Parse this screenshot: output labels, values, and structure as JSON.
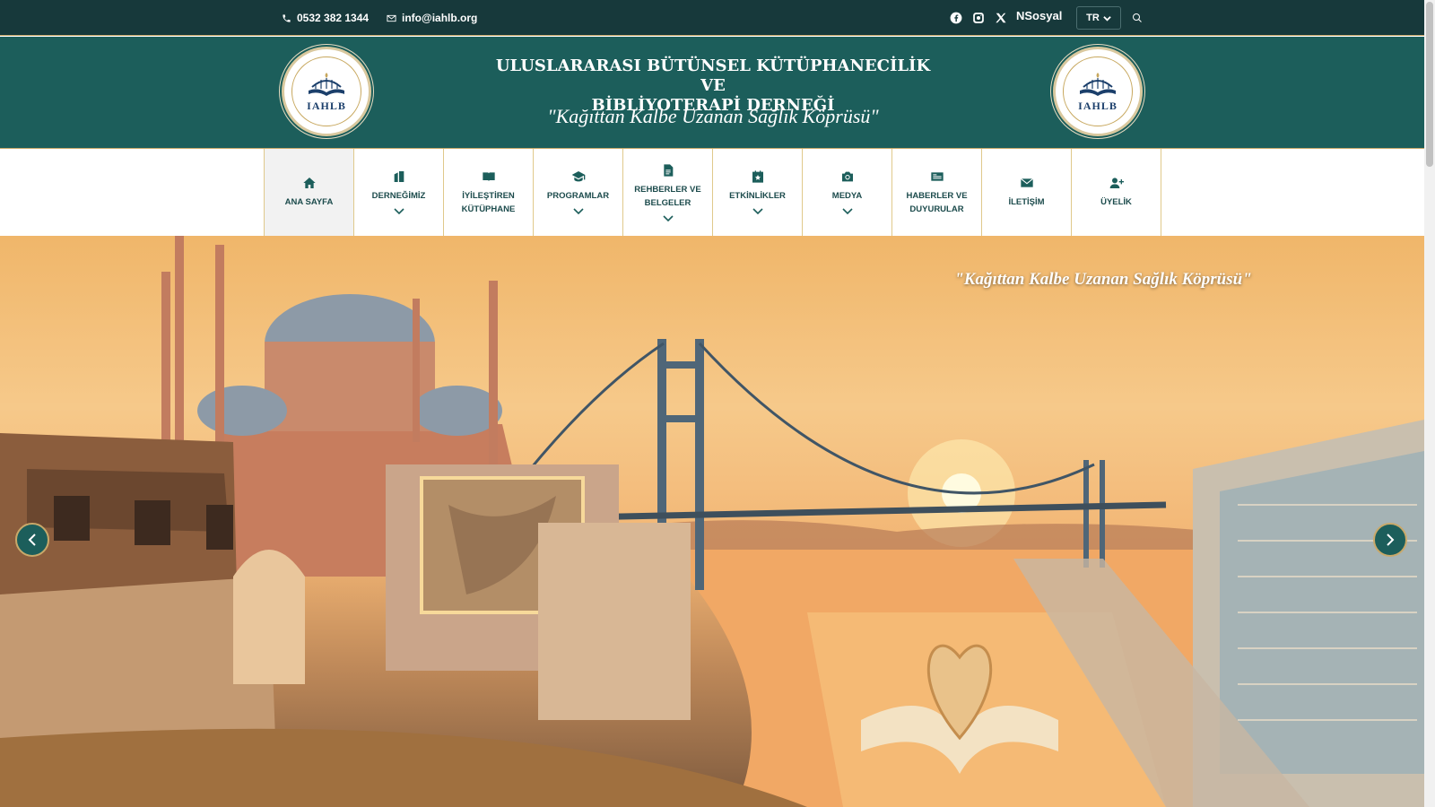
{
  "topbar": {
    "phone": "0532 382 1344",
    "email": "info@iahlb.org",
    "social": [
      "facebook-icon",
      "instagram-icon",
      "x-icon"
    ],
    "nsosyal": "NSosyal",
    "language": "TR"
  },
  "header": {
    "title_line1": "ULUSLARARASI BÜTÜNSEL KÜTÜPHANECİLİK VE",
    "title_line2": "BİBLİYOTERAPİ DERNEĞİ",
    "motto": "\"Kağıttan Kalbe Uzanan Sağlık Köprüsü\"",
    "logo_text": "IAHLB"
  },
  "nav": {
    "items": [
      {
        "label": "ANA SAYFA",
        "icon": "home-icon",
        "dropdown": false,
        "active": true
      },
      {
        "label": "DERNEĞİMİZ",
        "icon": "building-icon",
        "dropdown": true
      },
      {
        "label": "İYİLEŞTİREN KÜTÜPHANE",
        "icon": "book-icon",
        "dropdown": false
      },
      {
        "label": "PROGRAMLAR",
        "icon": "graduation-cap-icon",
        "dropdown": true
      },
      {
        "label": "REHBERLER VE BELGELER",
        "icon": "document-icon",
        "dropdown": true
      },
      {
        "label": "ETKİNLİKLER",
        "icon": "calendar-star-icon",
        "dropdown": true
      },
      {
        "label": "MEDYA",
        "icon": "camera-icon",
        "dropdown": true
      },
      {
        "label": "HABERLER VE DUYURULAR",
        "icon": "newspaper-icon",
        "dropdown": false
      },
      {
        "label": "İLETİŞİM",
        "icon": "envelope-icon",
        "dropdown": false
      },
      {
        "label": "ÜYELİK",
        "icon": "user-plus-icon",
        "dropdown": false
      }
    ]
  },
  "hero": {
    "motto": "\"Kağıttan Kalbe Uzanan Sağlık Köprüsü\""
  },
  "colors": {
    "topbar": "#17393b",
    "header": "#1c5e5b",
    "accent": "#c9a96a"
  }
}
